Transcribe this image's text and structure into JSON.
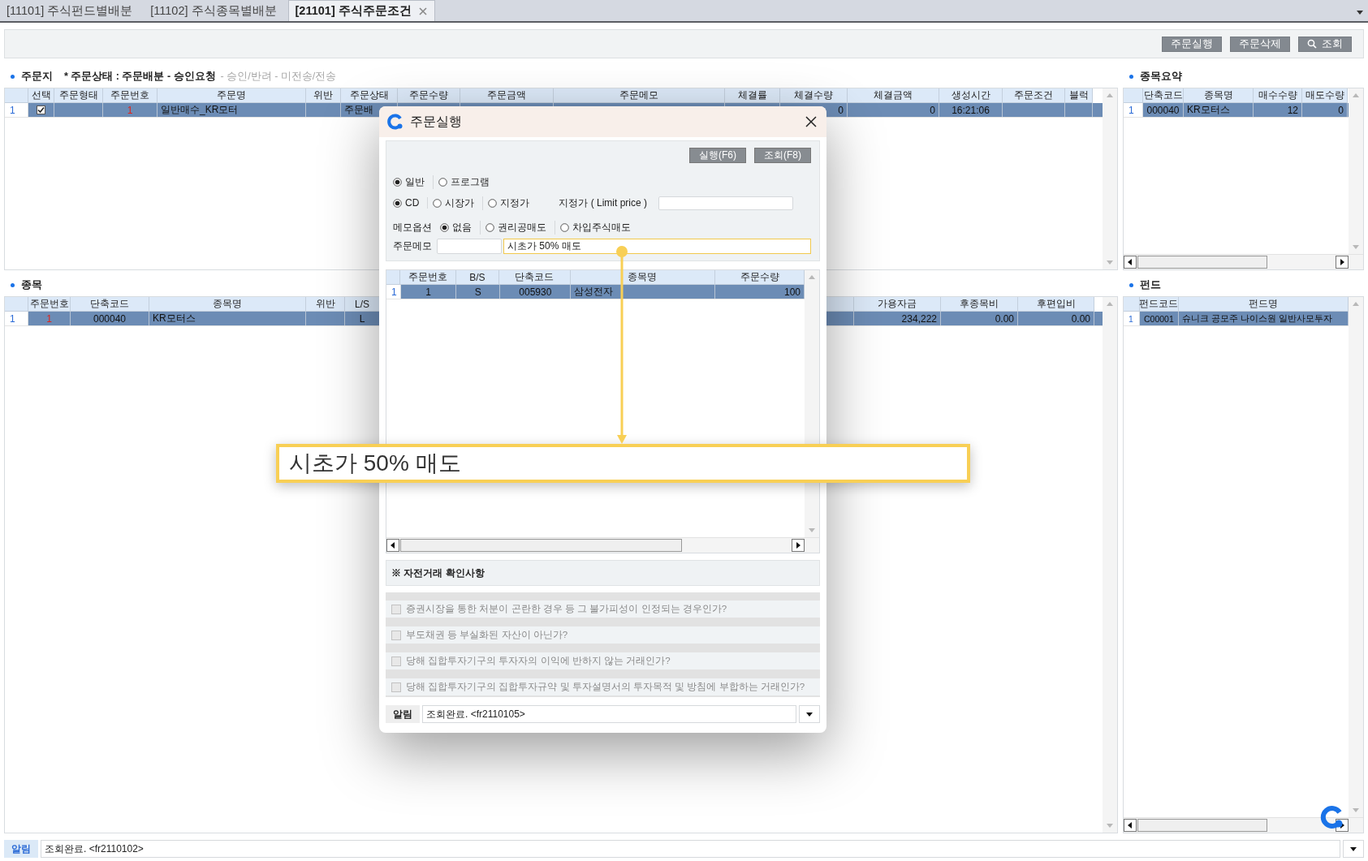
{
  "tabs": [
    {
      "label": "[11101] 주식펀드별배분",
      "selected": false
    },
    {
      "label": "[11102] 주식종목별배분",
      "selected": false
    },
    {
      "label": "[21101] 주식주문조건",
      "selected": true
    }
  ],
  "toolbar": {
    "buttons": [
      {
        "label": "주문실행",
        "kind": "plain"
      },
      {
        "label": "주문삭제",
        "kind": "plain"
      },
      {
        "label": "조회",
        "kind": "search"
      }
    ]
  },
  "order_section": {
    "title": "주문지",
    "status_current": "* 주문상태 : 주문배분 - 승인요청",
    "status_rest": "- 승인/반려 - 미전송/전송",
    "grid": {
      "columns": [
        "선택",
        "주문형태",
        "주문번호",
        "주문명",
        "위반",
        "주문상태",
        "주문수량",
        "주문금액",
        "주문메모",
        "체결률",
        "체결수량",
        "체결금액",
        "생성시간",
        "주문조건",
        "블럭"
      ],
      "rows": [
        {
          "num": "1",
          "selected": true,
          "cells": [
            {
              "kind": "checkbox",
              "checked": true
            },
            {
              "kind": "empty"
            },
            {
              "kind": "text",
              "text": "1"
            },
            {
              "kind": "text",
              "text": "일반매수_KR모터"
            },
            {
              "kind": "empty"
            },
            {
              "kind": "text",
              "text": "주문배"
            },
            {
              "kind": "empty"
            },
            {
              "kind": "empty"
            },
            {
              "kind": "empty"
            },
            {
              "kind": "empty"
            },
            {
              "kind": "text",
              "text": "0"
            },
            {
              "kind": "text",
              "text": "0"
            },
            {
              "kind": "text",
              "text": "16:21:06"
            },
            {
              "kind": "empty"
            },
            {
              "kind": "empty"
            }
          ]
        }
      ]
    }
  },
  "summary_section": {
    "title": "종목요약",
    "grid": {
      "columns": [
        "단축코드",
        "종목명",
        "매수수량",
        "매도수량"
      ],
      "rows": [
        {
          "num": "1",
          "selected": true,
          "cells": [
            {
              "kind": "text",
              "text": "000040"
            },
            {
              "kind": "text",
              "text": "KR모터스"
            },
            {
              "kind": "text",
              "text": "12"
            },
            {
              "kind": "text",
              "text": "0"
            }
          ]
        }
      ]
    }
  },
  "stock_section": {
    "title": "종목",
    "grid": {
      "columns": [
        "주문번호",
        "단축코드",
        "종목명",
        "위반",
        "L/S",
        "가용자금",
        "후종목비",
        "후편입비"
      ],
      "rows": [
        {
          "num": "1",
          "selected": true,
          "cells": [
            {
              "kind": "text",
              "text": "1"
            },
            {
              "kind": "text",
              "text": "000040"
            },
            {
              "kind": "text",
              "text": "KR모터스"
            },
            {
              "kind": "empty"
            },
            {
              "kind": "text",
              "text": "L"
            },
            {
              "kind": "text",
              "text": "234,222"
            },
            {
              "kind": "text",
              "text": "0.00"
            },
            {
              "kind": "text",
              "text": "0.00"
            }
          ]
        }
      ]
    }
  },
  "fund_section": {
    "title": "펀드",
    "grid": {
      "columns": [
        "펀드코드",
        "펀드명"
      ],
      "rows": [
        {
          "num": "1",
          "selected": true,
          "cells": [
            {
              "kind": "text",
              "text": "C00001"
            },
            {
              "kind": "text",
              "text": "슈니크 공모주 나이스원 일반사모투자"
            }
          ]
        }
      ]
    }
  },
  "status_bar": {
    "label": "알림",
    "message": "조회완료. <fr2110102>"
  },
  "dialog": {
    "title": "주문실행",
    "buttons": [
      "실행(F6)",
      "조회(F8)"
    ],
    "order_type": [
      {
        "label": "일반",
        "selected": true
      },
      {
        "label": "프로그램",
        "selected": false
      }
    ],
    "price_type": [
      {
        "label": "CD",
        "selected": true
      },
      {
        "label": "시장가",
        "selected": false
      },
      {
        "label": "지정가",
        "selected": false
      }
    ],
    "limit_price": {
      "label": "지정가 ( Limit price )"
    },
    "memo_option": {
      "label": "메모옵션",
      "options": [
        {
          "label": "없음",
          "selected": true
        },
        {
          "label": "권리공매도",
          "selected": false
        },
        {
          "label": "차입주식매도",
          "selected": false
        }
      ]
    },
    "memo": {
      "label": "주문메모",
      "value": "시초가 50% 매도"
    },
    "grid": {
      "columns": [
        "주문번호",
        "B/S",
        "단축코드",
        "종목명",
        "주문수량"
      ],
      "rows": [
        {
          "num": "1",
          "selected": true,
          "cells": [
            {
              "kind": "text",
              "text": "1"
            },
            {
              "kind": "text",
              "text": "S"
            },
            {
              "kind": "text",
              "text": "005930"
            },
            {
              "kind": "text",
              "text": "삼성전자"
            },
            {
              "kind": "text",
              "text": "100"
            }
          ]
        }
      ]
    },
    "checklist": {
      "title": "※ 자전거래 확인사항",
      "items": [
        {
          "label": "증권시장을 통한 처분이 곤란한 경우 등 그 불가피성이 인정되는 경우인가?",
          "checked": false,
          "disabled": true
        },
        {
          "label": "부도채권 등 부실화된 자산이 아닌가?",
          "checked": false,
          "disabled": true
        },
        {
          "label": "당해 집합투자기구의 투자자의 이익에 반하지 않는 거래인가?",
          "checked": false,
          "disabled": true
        },
        {
          "label": "당해 집합투자기구의 집합투자규약 및 투자설명서의 투자목적 및 방침에 부합하는 거래인가?",
          "checked": false,
          "disabled": true
        }
      ]
    },
    "status": {
      "label": "알림",
      "message": "조회완료. <fr2110105>"
    }
  },
  "callout": {
    "text": "시초가 50% 매도"
  }
}
